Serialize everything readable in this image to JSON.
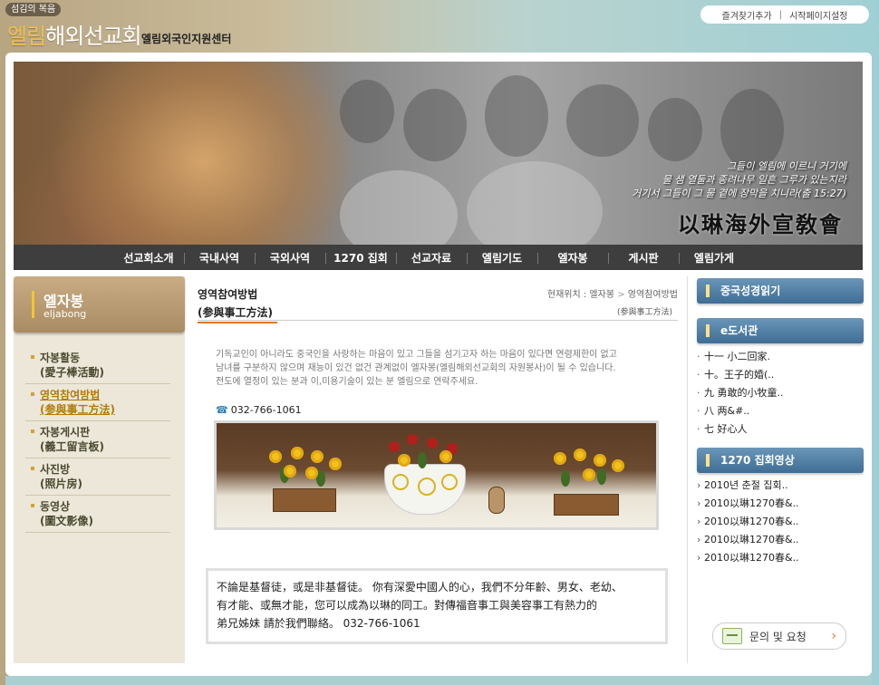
{
  "header": {
    "tagline": "섬김의 복음",
    "title_accent": "엘림",
    "title_rest": "해외선교회",
    "subtitle": "엘림외국인지원센터",
    "links": [
      "즐겨찾기추가",
      "시작페이지설정"
    ]
  },
  "banner": {
    "quote": [
      "그들이 엘림에 이르니 거기에",
      "물 샘 열둘과 종려나무 일흔 그루가 있는지라",
      "거기서 그들이 그 물 곁에 장막을 치니라(출 15:27)"
    ],
    "hanja": "以琳海外宣敎會"
  },
  "nav": [
    "선교회소개",
    "국내사역",
    "국외사역",
    "1270 집회",
    "선교자료",
    "엘림기도",
    "엘자봉",
    "게시판",
    "엘림가게"
  ],
  "sidebar": {
    "section_title": "엘자봉",
    "section_eng": "eljabong",
    "items": [
      {
        "label": "자봉활동",
        "sub": "(愛子棒活動)"
      },
      {
        "label": "영역참여방법",
        "sub": "(参與事工方法)"
      },
      {
        "label": "자봉게시판",
        "sub": "(義工留言板)"
      },
      {
        "label": "사진방",
        "sub": "(照片房)"
      },
      {
        "label": "동영상",
        "sub": "(圖文影像)"
      }
    ]
  },
  "main": {
    "title": "영역참여방법",
    "subtitle": "(参與事工方法)",
    "breadcrumb": [
      "현재위치 : 엘자봉",
      "영역참여방법"
    ],
    "breadcrumb_sub": "(参與事工方法)",
    "intro": [
      "기독교인이 아니라도 중국인을 사랑하는 마음이 있고 그들을 섬기고자 하는 마음이 있다면 연령제한이 없고",
      "남녀를 구분하지 않으며 재능이 있건 없건 관계없이 엘자봉(엘림해외선교회의 자원봉사)이 될 수 있습니다.",
      "전도에 열정이 있는 분과 이,미용기술이 있는 분 엘림으로 연락주세요."
    ],
    "phone": "032-766-1061",
    "chinese_lines": [
      "不論是基督徒，或是非基督徒。 你有深愛中國人的心，我們不分年齡、男女、老幼、",
      "有才能、或無才能，您可以成為以琳的同工。對傳福音事工與美容事工有熱力的",
      "弟兄姊妹 請於我們聯絡。 032-766-1061"
    ]
  },
  "right": {
    "bible_heading": "중국성경읽기",
    "ebook_heading": "e도서관",
    "ebooks": [
      "十一 小二回家.",
      "十。王子的婚(..",
      "九 勇敢的小牧童..",
      "八 两&#..",
      "七 好心人"
    ],
    "video_heading": "1270 집회영상",
    "videos": [
      "2010년 춘절 집회..",
      "2010以琳1270春&..",
      "2010以琳1270春&..",
      "2010以琳1270春&..",
      "2010以琳1270春&.."
    ],
    "inquiry_label": "문의 및 요청"
  },
  "colors": {
    "accent": "#e07818",
    "nav_bg": "#3e3e3e",
    "sidebar_bg": "#ece7d8",
    "right_heading": "#4a7aa0"
  }
}
